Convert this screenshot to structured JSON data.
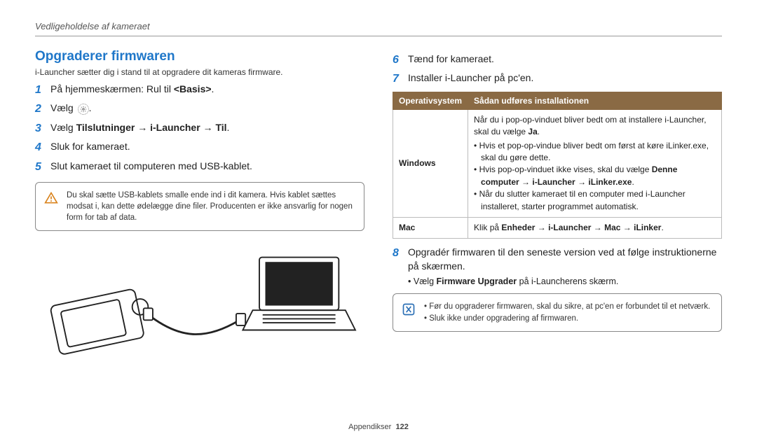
{
  "header": {
    "breadcrumb": "Vedligeholdelse af kameraet"
  },
  "left": {
    "title": "Opgraderer firmwaren",
    "intro": "i-Launcher sætter dig i stand til at opgradere dit kameras firmware.",
    "steps": {
      "s1": {
        "n": "1",
        "pre": "På hjemmeskærmen: Rul til ",
        "bold": "<Basis>",
        "post": "."
      },
      "s2": {
        "n": "2",
        "text": "Vælg ",
        "post": "."
      },
      "s3": {
        "n": "3",
        "pre": "Vælg ",
        "bold": "Tilslutninger → i-Launcher → Til",
        "post": "."
      },
      "s4": {
        "n": "4",
        "text": "Sluk for kameraet."
      },
      "s5": {
        "n": "5",
        "text": "Slut kameraet til computeren med USB-kablet."
      }
    },
    "callout": "Du skal sætte USB-kablets smalle ende ind i dit kamera. Hvis kablet sættes modsat i, kan dette ødelægge dine filer. Producenten er ikke ansvarlig for nogen form for tab af data."
  },
  "right": {
    "steps": {
      "s6": {
        "n": "6",
        "text": "Tænd for kameraet."
      },
      "s7": {
        "n": "7",
        "text": "Installer i-Launcher på pc'en."
      },
      "s8": {
        "n": "8",
        "text": "Opgradér firmwaren til den seneste version ved at følge instruktionerne på skærmen."
      }
    },
    "table": {
      "h1": "Operativsystem",
      "h2": "Sådan udføres installationen",
      "win_name": "Windows",
      "win_intro_a": "Når du i pop-op-vinduet bliver bedt om at installere i-Launcher, skal du vælge ",
      "win_intro_b": "Ja",
      "win_intro_c": ".",
      "win_li1": "Hvis et pop-op-vindue bliver bedt om først at køre iLinker.exe, skal du gøre dette.",
      "win_li2_a": "Hvis pop-op-vinduet ikke vises, skal du vælge ",
      "win_li2_b": "Denne computer → i-Launcher → iLinker.exe",
      "win_li2_c": ".",
      "win_li3": "Når du slutter kameraet til en computer med i-Launcher installeret, starter programmet automatisk.",
      "mac_name": "Mac",
      "mac_a": "Klik på ",
      "mac_b": "Enheder → i-Launcher → Mac → iLinker",
      "mac_c": "."
    },
    "sub_bullet_a": "Vælg ",
    "sub_bullet_b": "Firmware Upgrader",
    "sub_bullet_c": " på i-Launcherens skærm.",
    "callout": {
      "li1": "Før du opgraderer firmwaren, skal du sikre, at pc'en er forbundet til et netværk.",
      "li2": "Sluk ikke under opgradering af firmwaren."
    }
  },
  "footer": {
    "section": "Appendikser",
    "page": "122"
  }
}
